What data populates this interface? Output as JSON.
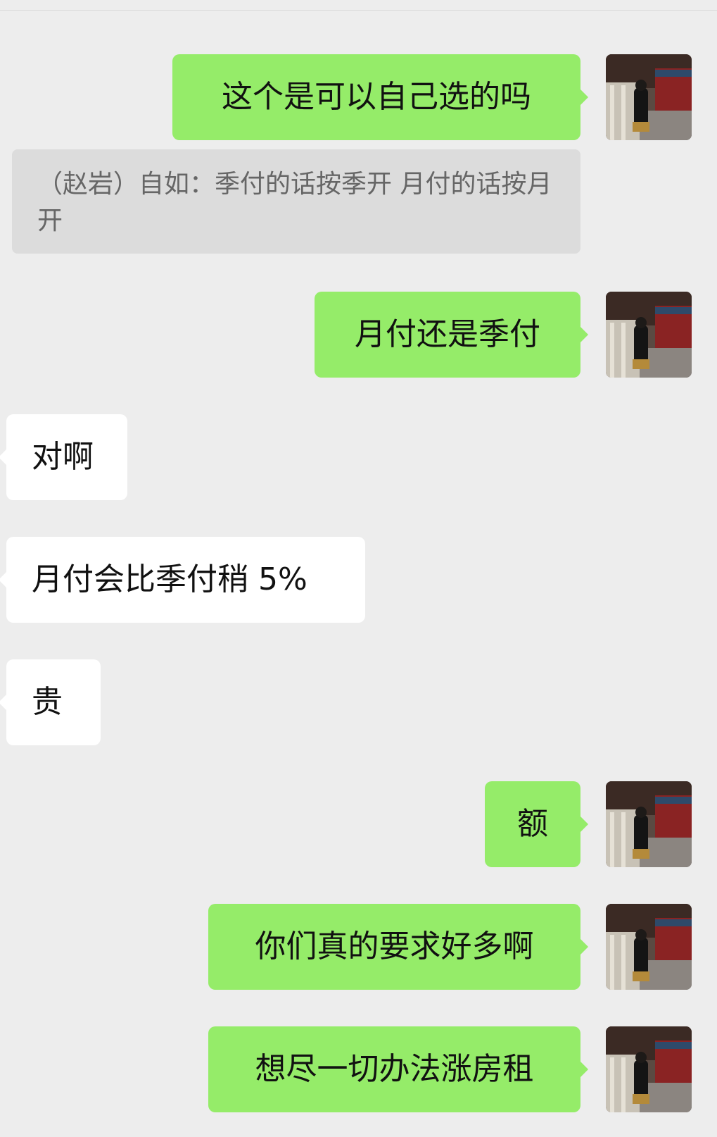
{
  "messages": [
    {
      "side": "me",
      "text": "这个是可以自己选的吗"
    },
    {
      "side": "quote",
      "text": "（赵岩）自如：季付的话按季开 月付的话按月开"
    },
    {
      "side": "me",
      "text": "月付还是季付"
    },
    {
      "side": "them",
      "text": "对啊"
    },
    {
      "side": "them",
      "text": "月付会比季付稍 5%"
    },
    {
      "side": "them",
      "text": "贵"
    },
    {
      "side": "me",
      "text": "额"
    },
    {
      "side": "me",
      "text": "你们真的要求好多啊"
    },
    {
      "side": "me",
      "text": "想尽一切办法涨房租"
    }
  ],
  "colors": {
    "background": "#ededed",
    "my_bubble": "#95ec69",
    "their_bubble": "#ffffff",
    "quote_bubble": "#dcdcdc"
  },
  "icons": {
    "avatar": "user-avatar-photo"
  }
}
